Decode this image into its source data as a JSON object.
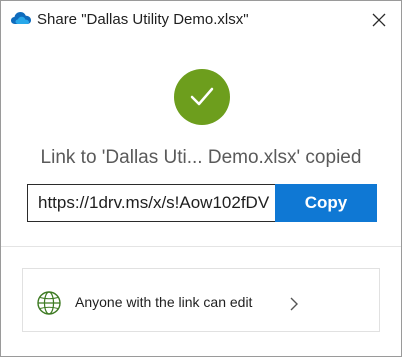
{
  "window": {
    "title": "Share \"Dallas Utility Demo.xlsx\"",
    "app_icon": "onedrive-cloud-icon",
    "close_icon": "close-icon"
  },
  "status": {
    "icon": "checkmark-icon",
    "icon_color": "#6d9e1d",
    "message": "Link to 'Dallas Uti... Demo.xlsx' copied"
  },
  "link": {
    "value": "https://1drv.ms/x/s!Aow102fDV",
    "copy_label": "Copy",
    "copy_color": "#0f78d4"
  },
  "permissions": {
    "icon": "globe-icon",
    "label": "Anyone with the link can edit",
    "chevron": "chevron-right-icon"
  }
}
